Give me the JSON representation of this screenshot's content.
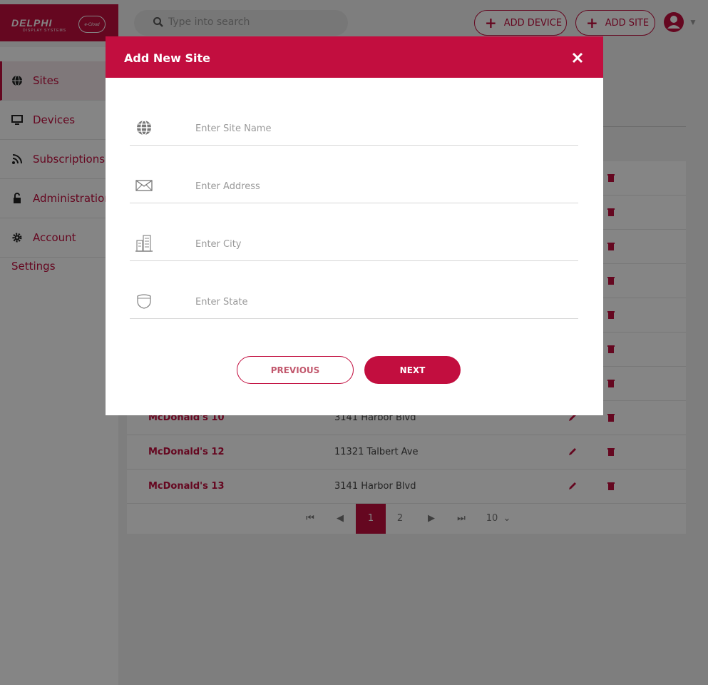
{
  "brand": {
    "name": "DELPHI",
    "sub": "DISPLAY SYSTEMS",
    "cloud": "e-Cloud"
  },
  "search": {
    "placeholder": "Type into search"
  },
  "header": {
    "add_device": "ADD DEVICE",
    "add_site": "ADD SITE"
  },
  "sidebar": {
    "items": [
      {
        "label": "Sites",
        "icon": "globe-icon"
      },
      {
        "label": "Devices",
        "icon": "monitor-icon"
      },
      {
        "label": "Subscriptions",
        "icon": "rss-icon"
      },
      {
        "label": "Administration",
        "icon": "lock-icon"
      },
      {
        "label": "Account",
        "icon": "gear-icon"
      }
    ],
    "extra": "Settings"
  },
  "table": {
    "rows": [
      {
        "name": "McDonald's 10",
        "address": "3141 Harbor Blvd"
      },
      {
        "name": "McDonald's 12",
        "address": "11321 Talbert Ave"
      },
      {
        "name": "McDonald's 13",
        "address": "3141 Harbor Blvd"
      }
    ]
  },
  "pagination": {
    "current": "1",
    "next_page": "2",
    "page_size": "10"
  },
  "modal": {
    "title": "Add New Site",
    "fields": [
      {
        "placeholder": "Enter Site Name",
        "icon": "globe-icon"
      },
      {
        "placeholder": "Enter Address",
        "icon": "envelope-icon"
      },
      {
        "placeholder": "Enter City",
        "icon": "building-icon"
      },
      {
        "placeholder": "Enter State",
        "icon": "shield-icon"
      }
    ],
    "previous": "PREVIOUS",
    "next": "NEXT"
  },
  "colors": {
    "accent": "#c20e3f"
  }
}
